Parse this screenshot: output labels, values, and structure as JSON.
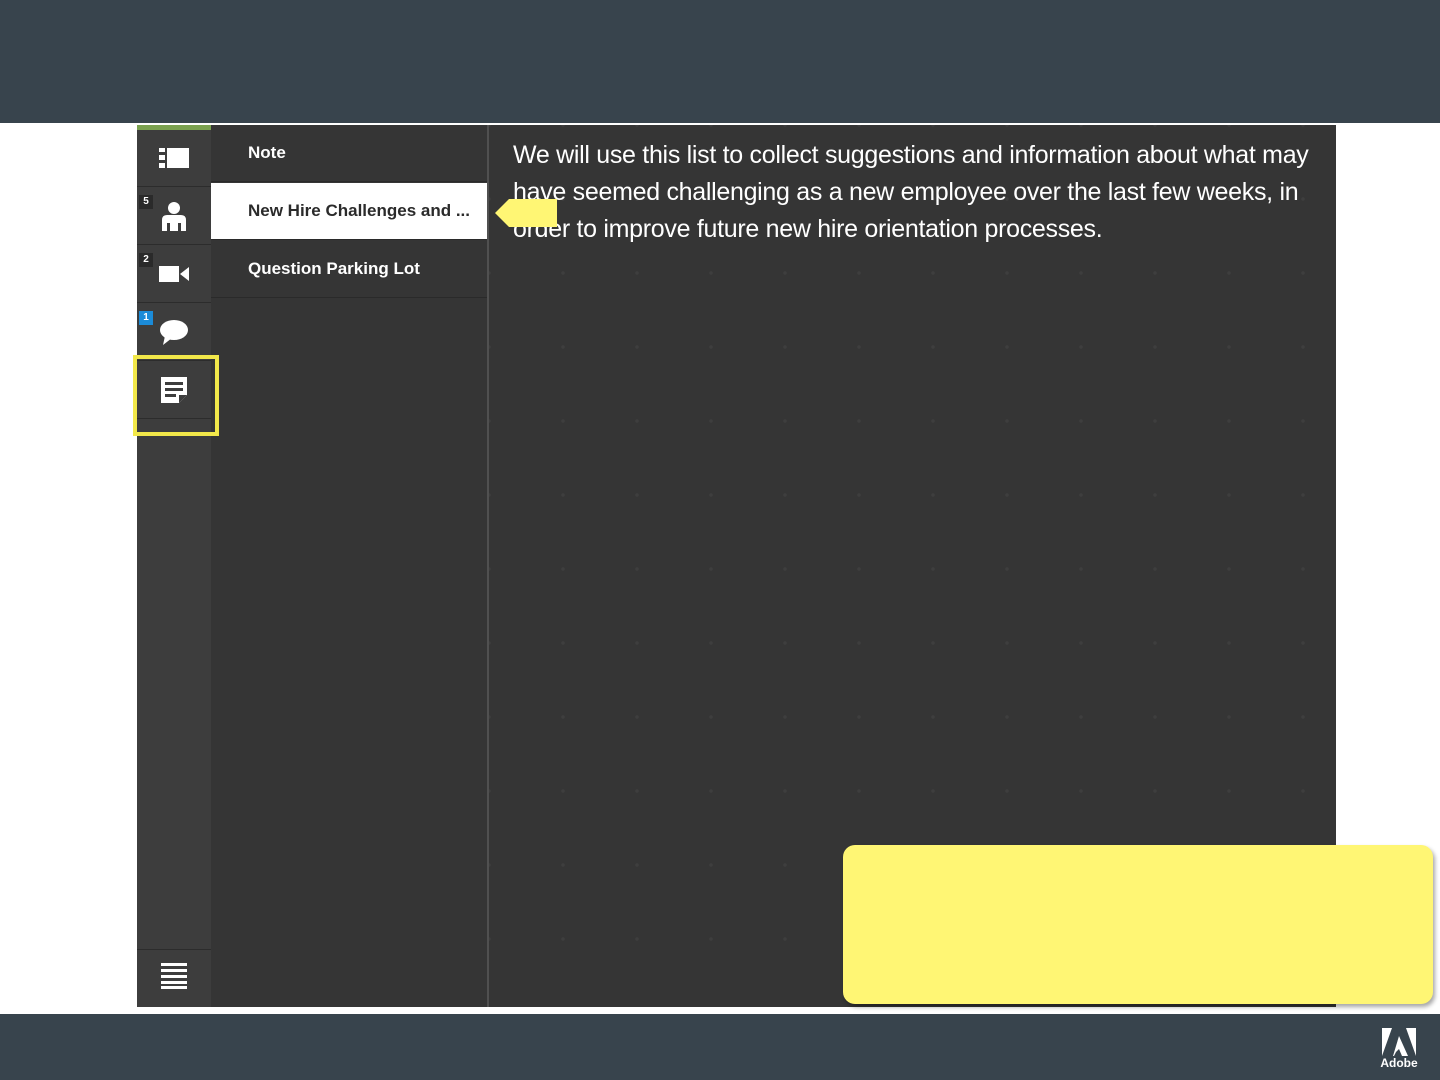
{
  "rail": {
    "items": [
      {
        "name": "layout",
        "icon": "layout-icon",
        "badge": ""
      },
      {
        "name": "attendees",
        "icon": "person-icon",
        "badge": "5"
      },
      {
        "name": "video",
        "icon": "video-camera-icon",
        "badge": "2"
      },
      {
        "name": "chat",
        "icon": "chat-bubble-icon",
        "badge": "1"
      },
      {
        "name": "notes",
        "icon": "notes-icon",
        "badge": ""
      }
    ],
    "menu_icon": "menu-icon",
    "accent_color": "#7aa14f",
    "badge_color": "#1b8bd8"
  },
  "list": {
    "items": [
      {
        "label": "Note",
        "selected": false
      },
      {
        "label": "New Hire Challenges and ...",
        "selected": true
      },
      {
        "label": "Question Parking Lot",
        "selected": false
      }
    ]
  },
  "content": {
    "text": "We will use this list to collect suggestions and information about what may have seemed challenging as a new employee over the last few weeks, in order to improve future new hire orientation processes."
  },
  "callout": {
    "text": "",
    "color": "#fff674"
  },
  "highlight_color": "#f2e84a",
  "footer": {
    "brand": "Adobe"
  }
}
